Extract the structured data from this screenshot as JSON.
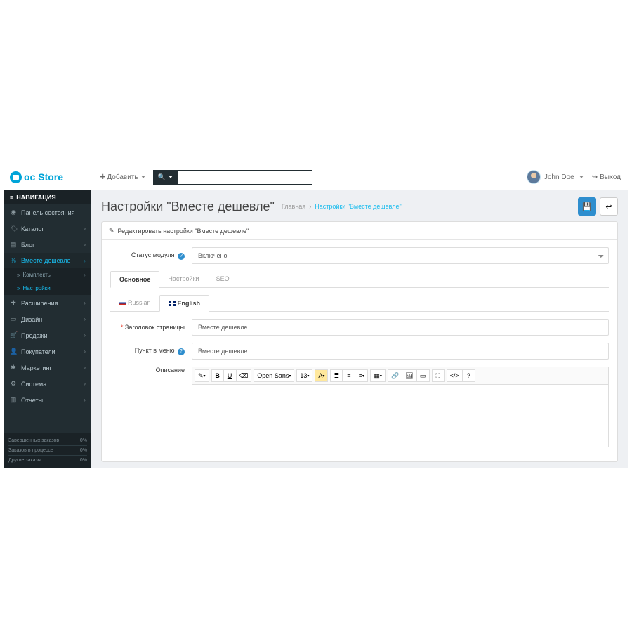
{
  "logo": {
    "text": "oc Store"
  },
  "header": {
    "add_label": "Добавить",
    "user_name": "John Doe",
    "logout_label": "Выход"
  },
  "nav": {
    "title": "НАВИГАЦИЯ",
    "items": [
      {
        "label": "Панель состояния"
      },
      {
        "label": "Каталог"
      },
      {
        "label": "Блог"
      },
      {
        "label": "Вместе дешевле"
      },
      {
        "label": "Расширения"
      },
      {
        "label": "Дизайн"
      },
      {
        "label": "Продажи"
      },
      {
        "label": "Покупатели"
      },
      {
        "label": "Маркетинг"
      },
      {
        "label": "Система"
      },
      {
        "label": "Отчеты"
      }
    ],
    "sub": [
      {
        "label": "Комплекты"
      },
      {
        "label": "Настройки"
      }
    ],
    "stats": [
      {
        "label": "Завершенных заказов",
        "value": "0%"
      },
      {
        "label": "Заказов в процессе",
        "value": "0%"
      },
      {
        "label": "Другие заказы",
        "value": "0%"
      }
    ]
  },
  "page": {
    "title": "Настройки \"Вместе дешевле\"",
    "breadcrumb_home": "Главная",
    "breadcrumb_current": "Настройки \"Вместе дешевле\""
  },
  "panel": {
    "heading": "Редактировать настройки \"Вместе дешевле\""
  },
  "form": {
    "status_label": "Статус модуля",
    "status_value": "Включено",
    "tabs": {
      "main": "Основное",
      "settings": "Настройки",
      "seo": "SEO"
    },
    "langs": {
      "ru": "Russian",
      "en": "English"
    },
    "page_title_label": "Заголовок страницы",
    "page_title_value": "Вместе дешевле",
    "menu_label": "Пункт в меню",
    "menu_value": "Вместе дешевле",
    "description_label": "Описание",
    "editor": {
      "font": "Open Sans",
      "size": "13"
    }
  }
}
